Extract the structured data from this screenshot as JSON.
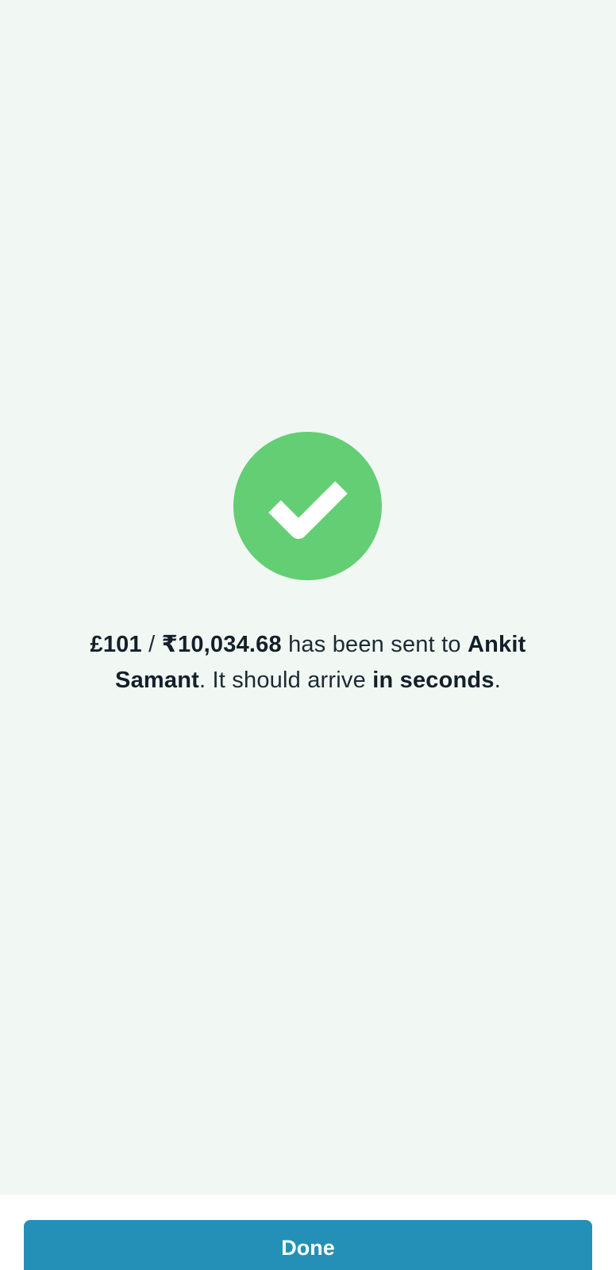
{
  "icon": {
    "name": "check-icon",
    "color": "#63ce73",
    "check_color": "#ffffff"
  },
  "message": {
    "amount_gbp": "£101",
    "separator": " / ",
    "amount_inr": "₹10,034.68",
    "text_sent": " has been sent to ",
    "recipient": "Ankit Samant",
    "text_arrive": ". It should arrive ",
    "arrival": "in seconds",
    "end": "."
  },
  "footer": {
    "done_label": "Done",
    "button_color": "#2490b8"
  }
}
